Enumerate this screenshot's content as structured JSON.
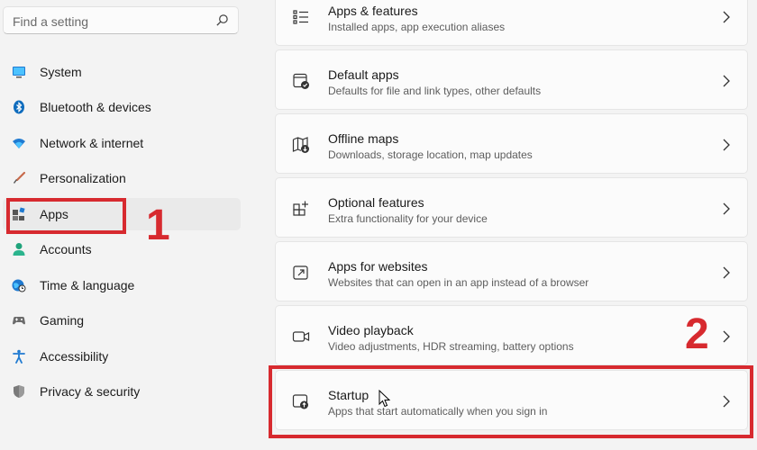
{
  "search": {
    "placeholder": "Find a setting",
    "icon": "search-icon"
  },
  "nav": {
    "items": [
      {
        "label": "System",
        "icon": "monitor-icon"
      },
      {
        "label": "Bluetooth & devices",
        "icon": "bluetooth-icon"
      },
      {
        "label": "Network & internet",
        "icon": "wifi-icon"
      },
      {
        "label": "Personalization",
        "icon": "brush-icon"
      },
      {
        "label": "Apps",
        "icon": "apps-icon",
        "selected": true
      },
      {
        "label": "Accounts",
        "icon": "person-icon"
      },
      {
        "label": "Time & language",
        "icon": "globe-clock-icon"
      },
      {
        "label": "Gaming",
        "icon": "gamepad-icon"
      },
      {
        "label": "Accessibility",
        "icon": "accessibility-icon"
      },
      {
        "label": "Privacy & security",
        "icon": "shield-icon"
      }
    ]
  },
  "cards": [
    {
      "title": "Apps & features",
      "subtitle": "Installed apps, app execution aliases",
      "icon": "list-icon"
    },
    {
      "title": "Default apps",
      "subtitle": "Defaults for file and link types, other defaults",
      "icon": "default-apps-icon"
    },
    {
      "title": "Offline maps",
      "subtitle": "Downloads, storage location, map updates",
      "icon": "map-icon"
    },
    {
      "title": "Optional features",
      "subtitle": "Extra functionality for your device",
      "icon": "grid-plus-icon"
    },
    {
      "title": "Apps for websites",
      "subtitle": "Websites that can open in an app instead of a browser",
      "icon": "link-window-icon"
    },
    {
      "title": "Video playback",
      "subtitle": "Video adjustments, HDR streaming, battery options",
      "icon": "video-icon"
    },
    {
      "title": "Startup",
      "subtitle": "Apps that start automatically when you sign in",
      "icon": "startup-icon"
    }
  ],
  "annotations": {
    "step1": "1",
    "step2": "2"
  },
  "colors": {
    "highlight": "#d72a2f",
    "accent": "#0067c0",
    "background": "#f3f3f3",
    "card": "#fbfbfb"
  }
}
